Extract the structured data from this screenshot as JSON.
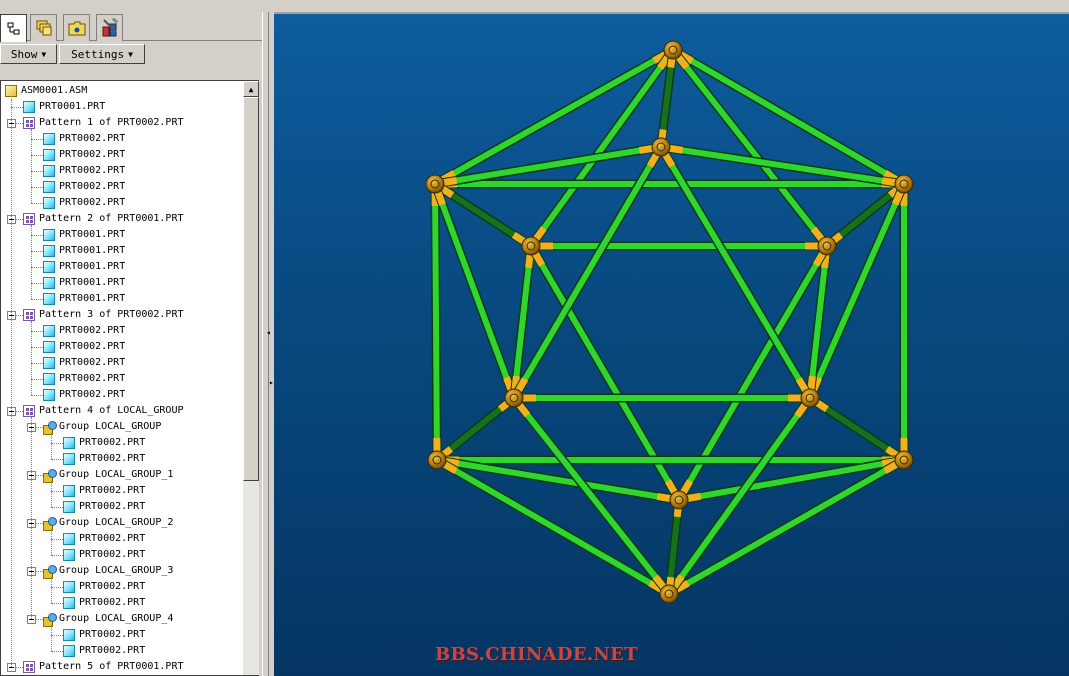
{
  "tabs": [
    {
      "name": "tab-model-tree",
      "icon": "model-tree-icon",
      "active": true
    },
    {
      "name": "tab-layers",
      "icon": "layers-icon",
      "active": false
    },
    {
      "name": "tab-folder-browser",
      "icon": "folder-browser-icon",
      "active": false
    },
    {
      "name": "tab-tools",
      "icon": "tools-icon",
      "active": false
    }
  ],
  "toolbar": {
    "show_label": "Show",
    "settings_label": "Settings"
  },
  "tree": [
    {
      "label": "ASM0001.ASM",
      "icon": "asm",
      "level": 0,
      "expander": false
    },
    {
      "label": "PRT0001.PRT",
      "icon": "part",
      "level": 1,
      "expander": false
    },
    {
      "label": "Pattern 1 of PRT0002.PRT",
      "icon": "pattern",
      "level": 1,
      "expander": true
    },
    {
      "label": "PRT0002.PRT",
      "icon": "part",
      "level": 2,
      "expander": false
    },
    {
      "label": "PRT0002.PRT",
      "icon": "part",
      "level": 2,
      "expander": false
    },
    {
      "label": "PRT0002.PRT",
      "icon": "part",
      "level": 2,
      "expander": false
    },
    {
      "label": "PRT0002.PRT",
      "icon": "part",
      "level": 2,
      "expander": false
    },
    {
      "label": "PRT0002.PRT",
      "icon": "part",
      "level": 2,
      "expander": false
    },
    {
      "label": "Pattern 2 of PRT0001.PRT",
      "icon": "pattern",
      "level": 1,
      "expander": true
    },
    {
      "label": "PRT0001.PRT",
      "icon": "part",
      "level": 2,
      "expander": false
    },
    {
      "label": "PRT0001.PRT",
      "icon": "part",
      "level": 2,
      "expander": false
    },
    {
      "label": "PRT0001.PRT",
      "icon": "part",
      "level": 2,
      "expander": false
    },
    {
      "label": "PRT0001.PRT",
      "icon": "part",
      "level": 2,
      "expander": false
    },
    {
      "label": "PRT0001.PRT",
      "icon": "part",
      "level": 2,
      "expander": false
    },
    {
      "label": "Pattern 3 of PRT0002.PRT",
      "icon": "pattern",
      "level": 1,
      "expander": true
    },
    {
      "label": "PRT0002.PRT",
      "icon": "part",
      "level": 2,
      "expander": false
    },
    {
      "label": "PRT0002.PRT",
      "icon": "part",
      "level": 2,
      "expander": false
    },
    {
      "label": "PRT0002.PRT",
      "icon": "part",
      "level": 2,
      "expander": false
    },
    {
      "label": "PRT0002.PRT",
      "icon": "part",
      "level": 2,
      "expander": false
    },
    {
      "label": "PRT0002.PRT",
      "icon": "part",
      "level": 2,
      "expander": false
    },
    {
      "label": "Pattern 4 of LOCAL_GROUP",
      "icon": "pattern",
      "level": 1,
      "expander": true
    },
    {
      "label": "Group LOCAL_GROUP",
      "icon": "group",
      "level": 2,
      "expander": true
    },
    {
      "label": "PRT0002.PRT",
      "icon": "part",
      "level": 3,
      "expander": false
    },
    {
      "label": "PRT0002.PRT",
      "icon": "part",
      "level": 3,
      "expander": false
    },
    {
      "label": "Group LOCAL_GROUP_1",
      "icon": "group",
      "level": 2,
      "expander": true
    },
    {
      "label": "PRT0002.PRT",
      "icon": "part",
      "level": 3,
      "expander": false
    },
    {
      "label": "PRT0002.PRT",
      "icon": "part",
      "level": 3,
      "expander": false
    },
    {
      "label": "Group LOCAL_GROUP_2",
      "icon": "group",
      "level": 2,
      "expander": true
    },
    {
      "label": "PRT0002.PRT",
      "icon": "part",
      "level": 3,
      "expander": false
    },
    {
      "label": "PRT0002.PRT",
      "icon": "part",
      "level": 3,
      "expander": false
    },
    {
      "label": "Group LOCAL_GROUP_3",
      "icon": "group",
      "level": 2,
      "expander": true
    },
    {
      "label": "PRT0002.PRT",
      "icon": "part",
      "level": 3,
      "expander": false
    },
    {
      "label": "PRT0002.PRT",
      "icon": "part",
      "level": 3,
      "expander": false
    },
    {
      "label": "Group LOCAL_GROUP_4",
      "icon": "group",
      "level": 2,
      "expander": true
    },
    {
      "label": "PRT0002.PRT",
      "icon": "part",
      "level": 3,
      "expander": false
    },
    {
      "label": "PRT0002.PRT",
      "icon": "part",
      "level": 3,
      "expander": false
    },
    {
      "label": "Pattern 5 of PRT0001.PRT",
      "icon": "pattern",
      "level": 1,
      "expander": true
    }
  ],
  "viewport": {
    "watermark": "BBS.CHINADE.NET",
    "rod_color": "#2fd62f",
    "rod_dark_color": "#15701f",
    "joint_color": "#b8860b",
    "joint_highlight": "#f0b020",
    "background_color": "#0a5592"
  }
}
